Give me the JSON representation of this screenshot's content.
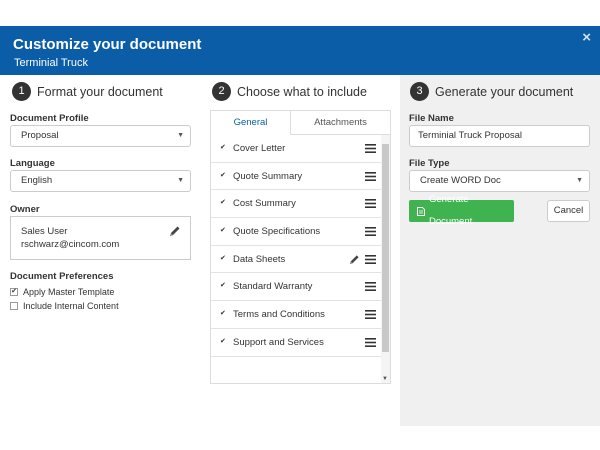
{
  "header": {
    "title": "Customize your document",
    "subtitle": "Terminial Truck",
    "close_symbol": "×"
  },
  "step1": {
    "number": "1",
    "title": "Format your document",
    "profile_label": "Document Profile",
    "profile_value": "Proposal",
    "language_label": "Language",
    "language_value": "English",
    "owner_label": "Owner",
    "owner_name": "Sales User",
    "owner_email": "rschwarz@cincom.com",
    "prefs_label": "Document Preferences",
    "prefs": [
      {
        "label": "Apply Master Template",
        "checked": true
      },
      {
        "label": "Include Internal Content",
        "checked": false
      }
    ]
  },
  "step2": {
    "number": "2",
    "title": "Choose what to include",
    "tabs": [
      "General",
      "Attachments"
    ],
    "items": [
      {
        "label": "Cover Letter",
        "checked": true,
        "editable": false
      },
      {
        "label": "Quote Summary",
        "checked": true,
        "editable": false
      },
      {
        "label": "Cost Summary",
        "checked": true,
        "editable": false
      },
      {
        "label": "Quote Specifications",
        "checked": true,
        "editable": false
      },
      {
        "label": "Data Sheets",
        "checked": true,
        "editable": true
      },
      {
        "label": "Standard Warranty",
        "checked": true,
        "editable": false
      },
      {
        "label": "Terms and Conditions",
        "checked": true,
        "editable": false
      },
      {
        "label": "Support and Services",
        "checked": true,
        "editable": false
      }
    ]
  },
  "step3": {
    "number": "3",
    "title": "Generate your document",
    "filename_label": "File Name",
    "filename_value": "Terminial Truck Proposal",
    "filetype_label": "File Type",
    "filetype_value": "Create WORD Doc",
    "generate_label": "Generate Document",
    "cancel_label": "Cancel"
  },
  "colors": {
    "header_bg": "#0b5da8",
    "generate_bg": "#3fb34f",
    "panel_bg": "#f0f0f0"
  }
}
